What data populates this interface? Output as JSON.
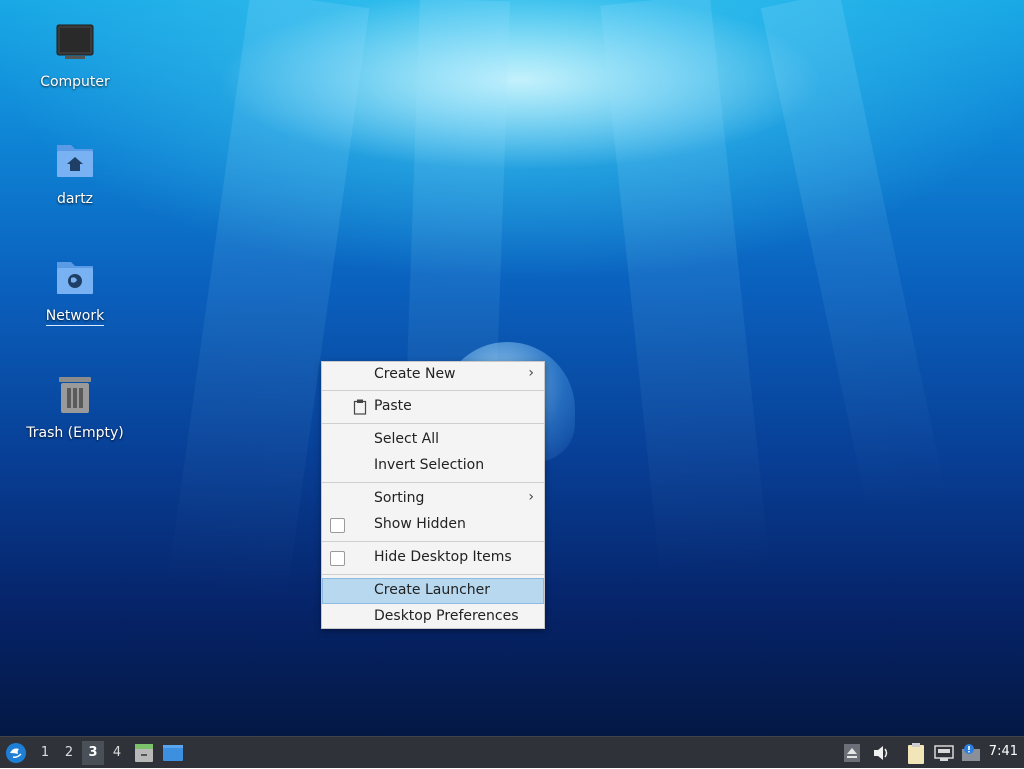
{
  "desktop": {
    "icons": [
      {
        "label": "Computer"
      },
      {
        "label": "dartz"
      },
      {
        "label": "Network"
      },
      {
        "label": "Trash (Empty)"
      }
    ]
  },
  "context_menu": {
    "items": {
      "create_new": "Create New",
      "paste": "Paste",
      "select_all": "Select All",
      "invert_selection": "Invert Selection",
      "sorting": "Sorting",
      "show_hidden": "Show Hidden",
      "hide_desktop_items": "Hide Desktop Items",
      "create_launcher": "Create Launcher",
      "desktop_preferences": "Desktop Preferences"
    },
    "highlighted": "Create Launcher",
    "show_hidden_checked": false,
    "hide_desktop_items_checked": false
  },
  "taskbar": {
    "workspaces": [
      "1",
      "2",
      "3",
      "4"
    ],
    "active_workspace": "3",
    "clock": "7:41"
  },
  "colors": {
    "menu_highlight": "#b7d8ef",
    "taskbar_bg": "#2f3339"
  }
}
